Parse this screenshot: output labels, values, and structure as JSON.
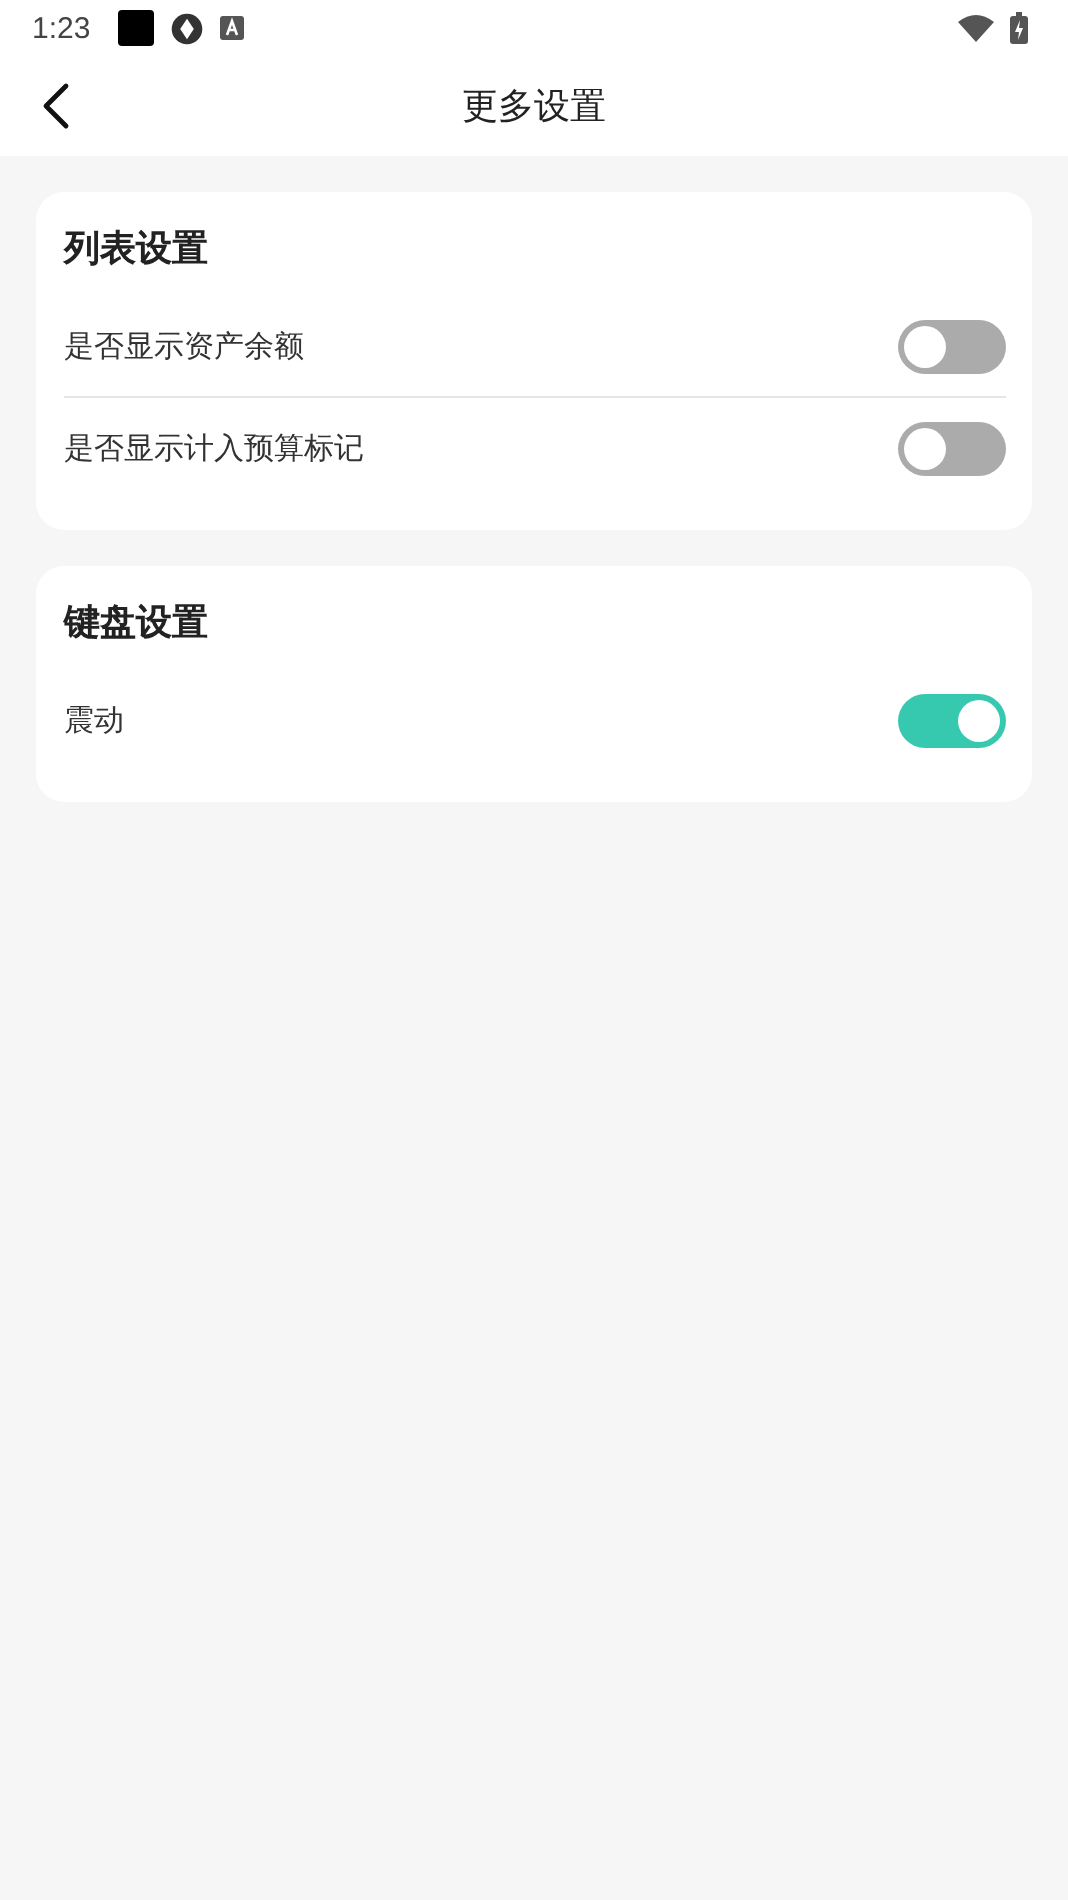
{
  "status_bar": {
    "time": "1:23"
  },
  "header": {
    "title": "更多设置"
  },
  "sections": [
    {
      "title": "列表设置",
      "items": [
        {
          "label": "是否显示资产余额",
          "on": false
        },
        {
          "label": "是否显示计入预算标记",
          "on": false
        }
      ]
    },
    {
      "title": "键盘设置",
      "items": [
        {
          "label": "震动",
          "on": true
        }
      ]
    }
  ]
}
